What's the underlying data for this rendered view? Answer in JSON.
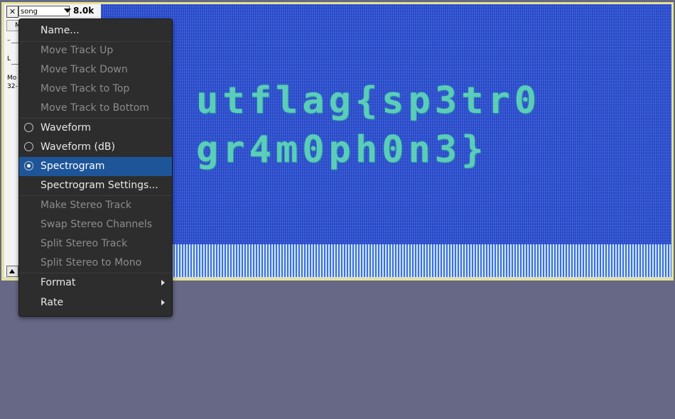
{
  "track": {
    "name": "song",
    "rate": "8.0k",
    "mute_label": "M",
    "gain_label": "–",
    "pan_label": "L",
    "info_line1": "Mo",
    "info_line2": "32-"
  },
  "spectrogram": {
    "text_line1": "utflag{sp3tr0",
    "text_line2": "gr4m0ph0n3}",
    "colors": {
      "background": "#2c46c8",
      "text": "#5fd8b8"
    }
  },
  "menu": {
    "items": {
      "name": "Name...",
      "move_up": "Move Track Up",
      "move_down": "Move Track Down",
      "move_top": "Move Track to Top",
      "move_bottom": "Move Track to Bottom",
      "waveform": "Waveform",
      "waveform_db": "Waveform (dB)",
      "spectrogram": "Spectrogram",
      "spectrogram_settings": "Spectrogram Settings...",
      "make_stereo": "Make Stereo Track",
      "swap_stereo": "Swap Stereo Channels",
      "split_stereo": "Split Stereo Track",
      "split_stereo_mono": "Split Stereo to Mono",
      "format": "Format",
      "rate": "Rate"
    },
    "selected_view": "Spectrogram",
    "colors": {
      "background": "#2d2d2d",
      "highlight": "#1e5599"
    }
  }
}
